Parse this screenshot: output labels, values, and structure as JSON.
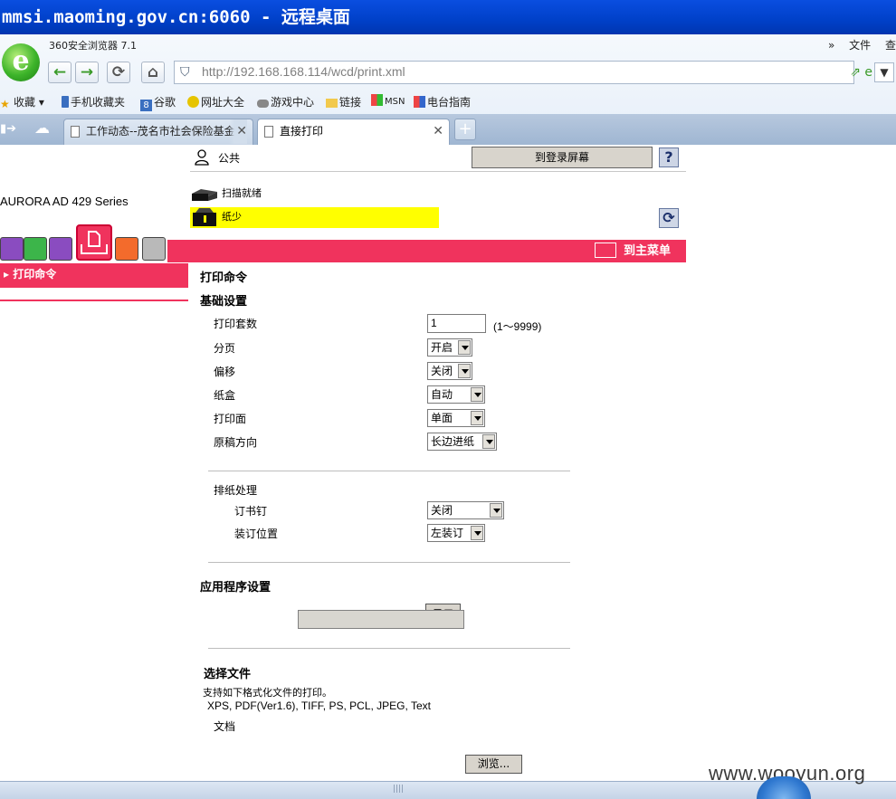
{
  "window": {
    "title": "mmsi.maoming.gov.cn:6060 - 远程桌面"
  },
  "browser": {
    "name": "360安全浏览器 7.1",
    "menu_items": [
      "文件",
      "查"
    ],
    "url": "http://192.168.168.114/wcd/print.xml",
    "bookmarks": [
      "收藏",
      "手机收藏夹",
      "谷歌",
      "网址大全",
      "游戏中心",
      "链接",
      "MSN",
      "电台指南"
    ],
    "tabs": [
      {
        "label": "工作动态--茂名市社会保险基金",
        "active": false
      },
      {
        "label": "直接打印",
        "active": true
      }
    ]
  },
  "header": {
    "user_label": "公共",
    "login_button": "到登录屏幕",
    "help": "?",
    "model": "AURORA AD 429 Series",
    "status_scan": "扫描就绪",
    "status_paper": "纸少",
    "main_menu": "到主菜单"
  },
  "sidebar": {
    "active_item": "打印命令"
  },
  "main": {
    "page_title": "打印命令",
    "basic_title": "基础设置",
    "copies_label": "打印套数",
    "copies_value": "1",
    "copies_range": "(1～9999)",
    "collate_label": "分页",
    "collate_value": "开启",
    "offset_label": "偏移",
    "offset_value": "关闭",
    "tray_label": "纸盒",
    "tray_value": "自动",
    "side_label": "打印面",
    "side_value": "单面",
    "orient_label": "原稿方向",
    "orient_value": "长边进纸",
    "finishing_label": "排纸处理",
    "staple_label": "订书钉",
    "staple_value": "关闭",
    "binding_label": "装订位置",
    "binding_value": "左装订",
    "app_title": "应用程序设置",
    "show_button": "显示",
    "file_title": "选择文件",
    "file_desc": "支持如下格式化文件的打印。",
    "file_formats": "XPS, PDF(Ver1.6), TIFF, PS, PCL, JPEG, Text",
    "doc_label": "文档",
    "browse_button": "浏览..."
  },
  "watermark": "www.wooyun.org",
  "colors": {
    "accent": "#f0335d",
    "warning": "#ffff00",
    "titlebar": "#0040c8"
  }
}
